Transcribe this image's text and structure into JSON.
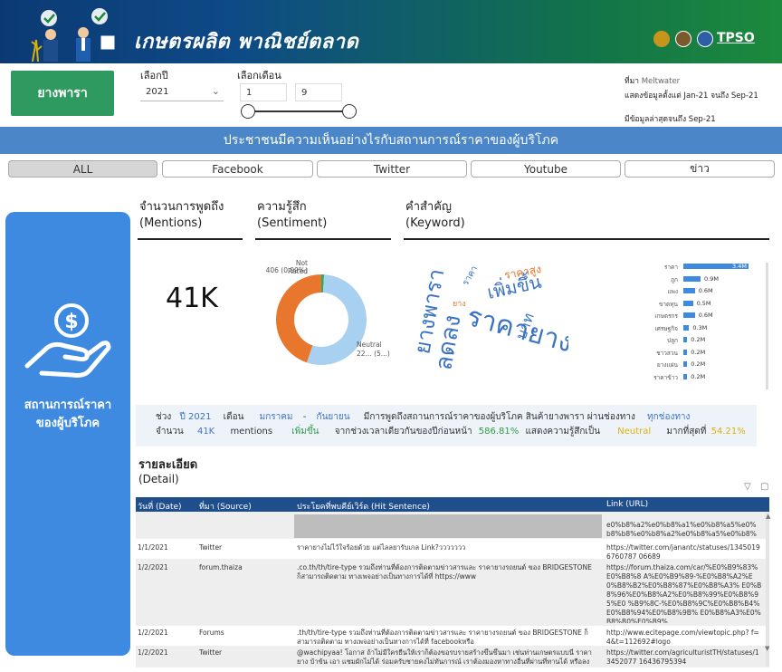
{
  "header": {
    "title": "เกษตรผลิต พาณิชย์ตลาด",
    "brand": "TPSO",
    "colors": {
      "start": "#0b3a73",
      "end": "#1c8a3c"
    }
  },
  "commodity_button": "ยางพารา",
  "filters": {
    "year_label": "เลือกปี",
    "year_value": "2021",
    "month_label": "เลือกเดือน",
    "month_start": "1",
    "month_end": "9"
  },
  "source_info": {
    "source_label": "ที่มา",
    "source_value": "Meltwater",
    "data_range": "แสดงข้อมูลตั้งแต่ Jan-21 จนถึง Sep-21",
    "latest": "มีข้อมูลล่าสุดจนถึง Sep-21"
  },
  "banner": "ประชาชนมีความเห็นอย่างไรกับสถานการณ์ราคาของผู้บริโภค",
  "tabs": [
    "ALL",
    "Facebook",
    "Twitter",
    "Youtube",
    "ข่าว"
  ],
  "left_panel": {
    "line1": "สถานการณ์ราคา",
    "line2": "ของผู้บริโภค"
  },
  "sections": {
    "mentions_th": "จำนวนการพูดถึง",
    "mentions_en": "(Mentions)",
    "sentiment_th": "ความรู้สึก",
    "sentiment_en": "(Sentiment)",
    "keyword_th": "คำสำคัญ",
    "keyword_en": "(Keyword)"
  },
  "mentions_value": "41K",
  "sentiment": {
    "not_rated_label": "Not Rated",
    "not_rated_value": "406 (0.99%)",
    "neutral_label": "Neutral",
    "neutral_value": "22... (5...)",
    "slices": [
      {
        "name": "Not Rated",
        "share": 0.99,
        "color": "#2faa5a"
      },
      {
        "name": "Neutral",
        "share": 54.21,
        "color": "#a8d0f0"
      },
      {
        "name": "Other",
        "share": 44.8,
        "color": "#e8762c"
      }
    ]
  },
  "wordcloud": [
    {
      "text": "ราคายาง",
      "color": "#3b73c4"
    },
    {
      "text": "ยางพารา",
      "color": "#3b73c4"
    },
    {
      "text": "เพิ่มขึ้น",
      "color": "#3b73c4"
    },
    {
      "text": "ลดลง",
      "color": "#3b73c4"
    },
    {
      "text": "ราคาสูง",
      "color": "#e8762c"
    },
    {
      "text": "ราคา",
      "color": "#3b73c4"
    },
    {
      "text": "บาท",
      "color": "#3b73c4"
    },
    {
      "text": "ยาง",
      "color": "#e8762c"
    }
  ],
  "keyword_bars": [
    {
      "label": "ราคา",
      "value": 3.4,
      "text": "3.4M"
    },
    {
      "label": "ถูก",
      "value": 0.9,
      "text": "0.9M"
    },
    {
      "label": "แพง",
      "value": 0.6,
      "text": "0.6M"
    },
    {
      "label": "ขาดทุน",
      "value": 0.5,
      "text": "0.5M"
    },
    {
      "label": "เกษตรกร",
      "value": 0.6,
      "text": "0.6M"
    },
    {
      "label": "เศรษฐกิจ",
      "value": 0.3,
      "text": "0.3M"
    },
    {
      "label": "ปลูก",
      "value": 0.2,
      "text": "0.2M"
    },
    {
      "label": "ชาวสวน",
      "value": 0.2,
      "text": "0.2M"
    },
    {
      "label": "ยางแผ่น",
      "value": 0.2,
      "text": "0.2M"
    },
    {
      "label": "ราคาข้าว",
      "value": 0.2,
      "text": "0.2M"
    }
  ],
  "summary": {
    "period_label": "ช่วง",
    "year": "ปี 2021",
    "month_label": "เดือน",
    "month_from": "มกราคม",
    "dash": "-",
    "month_to": "กันยายน",
    "text1": "มีการพูดถึงสถานการณ์ราคาของผู้บริโภค สินค้ายางพารา ผ่านช่องทาง",
    "channel": "ทุกช่องทาง",
    "count_label": "จำนวน",
    "count": "41K",
    "mentions": "mentions",
    "trend": "เพิ่มขึ้น",
    "text2": "จากช่วงเวลาเดียวกันของปีก่อนหน้า",
    "pct": "586.81%",
    "text3": "แสดงความรู้สึกเป็น",
    "sentiment": "Neutral",
    "text4": "มากที่สุดที่",
    "sentiment_pct": "54.21%"
  },
  "detail": {
    "title_th": "รายละเอียด",
    "title_en": "(Detail)"
  },
  "table": {
    "headers": [
      "วันที่ (Date)",
      "ที่มา (Source)",
      "ประโยคที่พบคีย์เวิร์ด (Hit Sentence)",
      "Link (URL)"
    ],
    "top_link": "e0%b8%a2%e0%b8%a1%e0%b8%a5%e0%b8%b8%e0%b8%a2%e0%b8%a5%e0%b8%87%e0",
    "rows": [
      {
        "date": "1/1/2021",
        "source": "Twitter",
        "sentence": "ราคายางไม่ไว้ใจร้อยด้วย แต่ไลลยารับเกล Link?ววววววว",
        "link": "https://twitter.com/janantc/statuses/13450196760787 06689"
      },
      {
        "date": "1/2/2021",
        "source": "forum.thaiza",
        "sentence": ".co.th/th/tire-type รวมถึงท่านที่ต้องการติดตามข่าวสารและ ราคายางรถยนต์ ของ BRIDGESTONE ก็สามารถติดตาม ทางเพจอย่างเป็นทางการได้ที่ https://www",
        "link": "https://forum.thaiza.com/car/%E0%B9%83%E0%B8%8 A%E0%B9%89-%E0%B8%A2%E0%B8%B2%E0%B8%87%E0%B8%A3% E0%B8%96%E0%B8%A2%E0%B8%99%E0%B8%95%E0 %B9%8C-%E0%B8%9C%E0%B8%B4%E0%B8%94%E0%B8%9B% E0%B8%A3%E0%B8%B0%E0%B9%"
      },
      {
        "date": "1/2/2021",
        "source": "Forums",
        "sentence": ".th/th/tire-type รวมถึงท่านที่ต้องการติดตามข่าวสารและ ราคายางรถยนต์ ของ BRIDGESTONE ก็สามารถติดตาม ทางเพจอย่างเป็นทางการได้ที่ facebookหรือ",
        "link": "http://www.ecitepage.com/viewtopic.php? f=4&t=112692#logo"
      },
      {
        "date": "1/2/2021",
        "source": "Twitter",
        "sentence": "@wachipyaa! โอกาส ถ้าไม่มีใครยืนให้เราก็ต้องขอรบรายสร้างขึ้นขึ้นมา เช่นท่านเกษตรแบบนี่ ราคายาง บ้าข้น เอา แชมผักไม่ได้ ร่อมครับชายคงไม่ทันการณ์ เราต้องมองหาทางอื่นที่ผ่านที่ทานได้ หรือลงทายจากเราให้ได้",
        "link": "https://twitter.com/agriculturistTH/statuses/13452077 16436795394"
      }
    ]
  }
}
